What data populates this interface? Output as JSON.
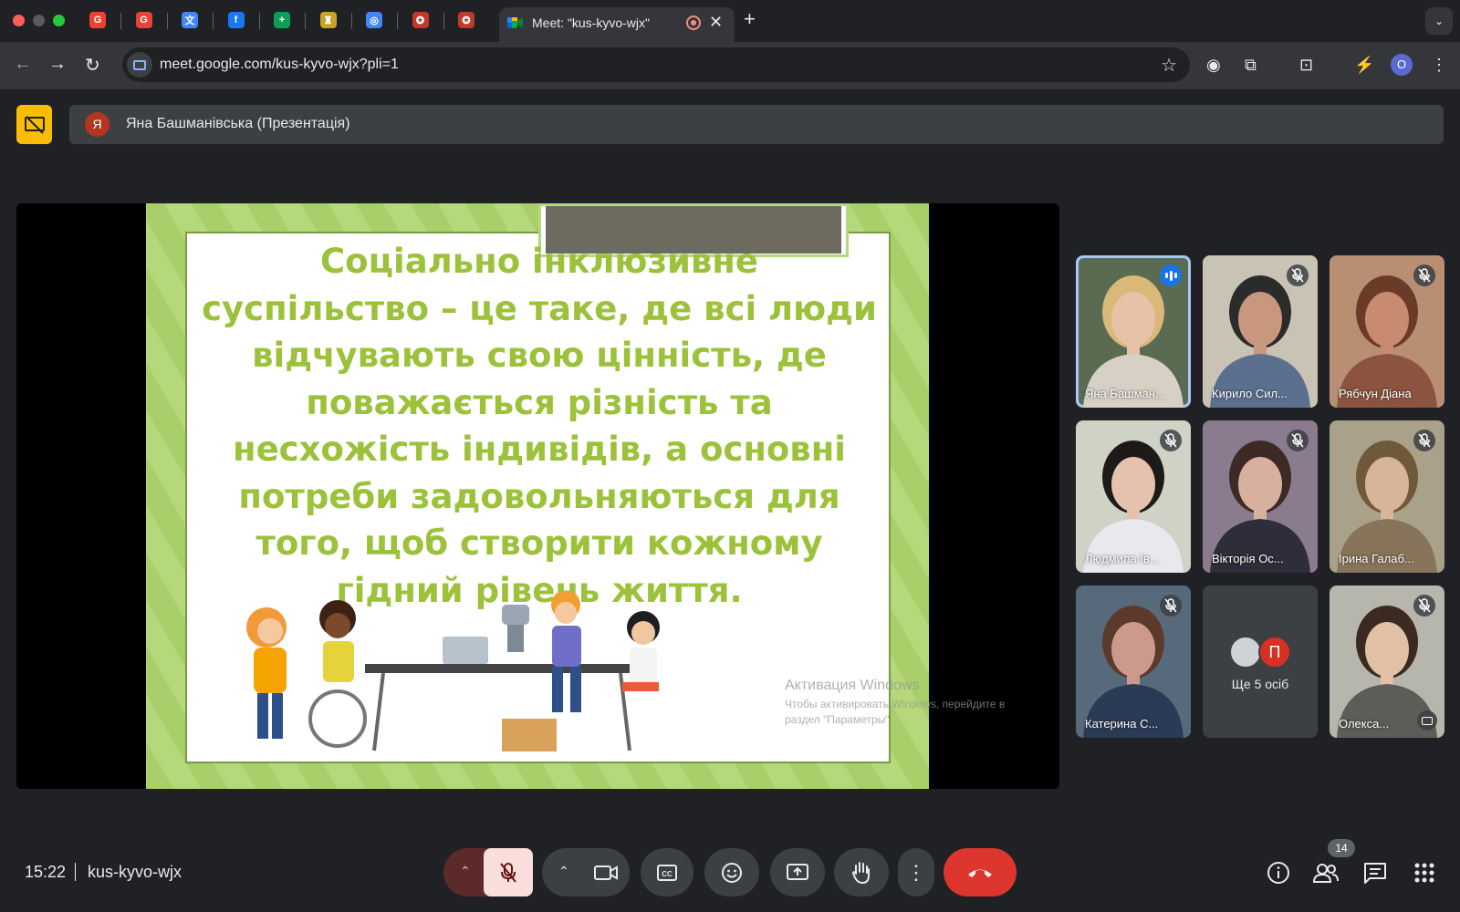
{
  "browser": {
    "tabs_pinned": [
      {
        "icon": "google-icon",
        "color": "#ea4335"
      },
      {
        "icon": "google-icon",
        "color": "#ea4335"
      },
      {
        "icon": "google-translate-icon",
        "color": "#4285f4"
      },
      {
        "icon": "facebook-icon",
        "color": "#1877f2"
      },
      {
        "icon": "google-sheets-icon",
        "color": "#0f9d58"
      },
      {
        "icon": "crest-icon",
        "color": "#c9a227"
      },
      {
        "icon": "target-icon",
        "color": "#4285f4"
      },
      {
        "icon": "seal-icon",
        "color": "#c0392b"
      },
      {
        "icon": "seal-icon",
        "color": "#c0392b"
      }
    ],
    "active_tab": {
      "title": "Meet: \"kus-kyvo-wjx\"",
      "icon": "google-meet-icon"
    },
    "url": "meet.google.com/kus-kyvo-wjx?pli=1",
    "profile_initial": "O",
    "profile_color": "#5b6ad0"
  },
  "meet": {
    "presenter_banner": {
      "avatar_letter": "Я",
      "text": "Яна Башманівська (Презентація)"
    },
    "slide": {
      "lines": [
        "Соціально інклюзивне",
        "суспільство – це таке, де всі люди",
        "відчувають свою цінність, де",
        "поважається різність та",
        "несхожість індивідів, а основні",
        "потреби задовольняються для",
        "того, щоб створити кожному",
        "гідний рівень життя."
      ],
      "text_color": "#9cc13a",
      "watermark_title": "Активация Windows",
      "watermark_text": "Чтобы активировать Windows, перейдите в раздел \"Параметры\"."
    },
    "participants": [
      {
        "name": "Яна Башман...",
        "state": "speaking",
        "bg": "#5a6b52",
        "skin": "#e8c2a8",
        "hair": "#d9b878",
        "shirt": "#d7d0c4"
      },
      {
        "name": "Кирило Сил...",
        "state": "muted",
        "bg": "#c9c3b5",
        "skin": "#c9977e",
        "hair": "#2b2b2b",
        "shirt": "#5b6f8f"
      },
      {
        "name": "Рябчун Діана",
        "state": "muted",
        "bg": "#b88f73",
        "skin": "#c98b70",
        "hair": "#6b3b28",
        "shirt": "#8c5440"
      },
      {
        "name": "Людмила Ів...",
        "state": "muted",
        "bg": "#cfd3c6",
        "skin": "#e4c2ad",
        "hair": "#1e1a1a",
        "shirt": "#e8e8ee"
      },
      {
        "name": "Вікторія Ос...",
        "state": "muted",
        "bg": "#8a7c8e",
        "skin": "#d8b0a0",
        "hair": "#3d2a25",
        "shirt": "#2d2e3a"
      },
      {
        "name": "Ірина Галаб...",
        "state": "muted",
        "bg": "#a9a18a",
        "skin": "#d8b49a",
        "hair": "#6e5a3a",
        "shirt": "#87745a"
      },
      {
        "name": "Катерина С...",
        "state": "muted",
        "bg": "#566a7c",
        "skin": "#cc9a8d",
        "hair": "#5b3a2b",
        "shirt": "#2c3b55"
      },
      {
        "name": "Олекса...",
        "state": "muted",
        "bg": "#b7b6ac",
        "skin": "#e1c0a6",
        "hair": "#3a2a20",
        "shirt": "#5e5c56"
      }
    ],
    "more_tile": {
      "label": "Ще 5 осіб",
      "avatar_letter": "П"
    },
    "bottom_bar": {
      "time": "15:22",
      "meeting_code": "kus-kyvo-wjx",
      "participants_count": "14"
    }
  }
}
